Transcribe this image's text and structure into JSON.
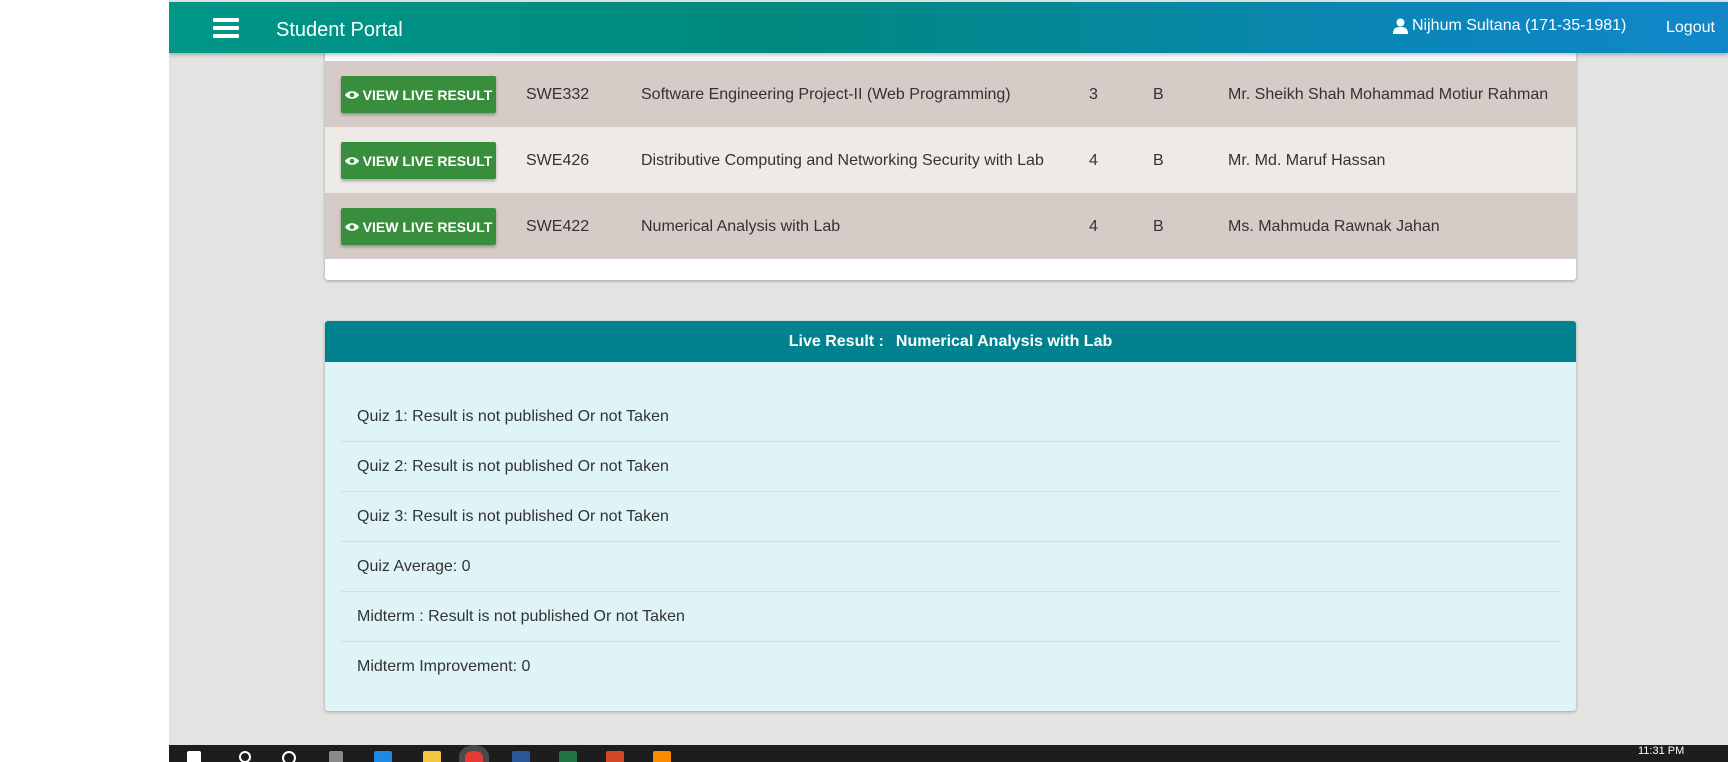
{
  "header": {
    "app_title": "Student Portal",
    "user_name": "Nijhum Sultana (171-35-1981)",
    "logout_label": "Logout"
  },
  "courses": [
    {
      "button": "VIEW LIVE RESULT",
      "code": "SWE332",
      "title": "Software Engineering Project-II (Web Programming)",
      "credit": "3",
      "section": "B",
      "teacher": "Mr. Sheikh Shah Mohammad Motiur Rahman"
    },
    {
      "button": "VIEW LIVE RESULT",
      "code": "SWE426",
      "title": "Distributive Computing and Networking Security with Lab",
      "credit": "4",
      "section": "B",
      "teacher": "Mr. Md. Maruf Hassan"
    },
    {
      "button": "VIEW LIVE RESULT",
      "code": "SWE422",
      "title": "Numerical Analysis with Lab",
      "credit": "4",
      "section": "B",
      "teacher": "Ms. Mahmuda Rawnak Jahan"
    }
  ],
  "live_result": {
    "label": "Live Result :",
    "course": "Numerical Analysis with Lab",
    "items": [
      "Quiz 1: Result is not published Or not Taken",
      "Quiz 2: Result is not published Or not Taken",
      "Quiz 3: Result is not published Or not Taken",
      "Quiz Average: 0",
      "Midterm : Result is not published Or not Taken",
      "Midterm Improvement: 0"
    ]
  },
  "taskbar": {
    "clock": "11:31 PM"
  },
  "colors": {
    "topbar_start": "#009688",
    "topbar_end": "#1187c9",
    "button_green": "#388e3c",
    "row_dark": "#d6cbc7",
    "row_light": "#eeeae8",
    "result_header": "#00838f",
    "result_body": "#dff4f7"
  },
  "icons": {
    "menu": "hamburger-menu-icon",
    "user": "user-icon",
    "view": "eye-icon"
  }
}
